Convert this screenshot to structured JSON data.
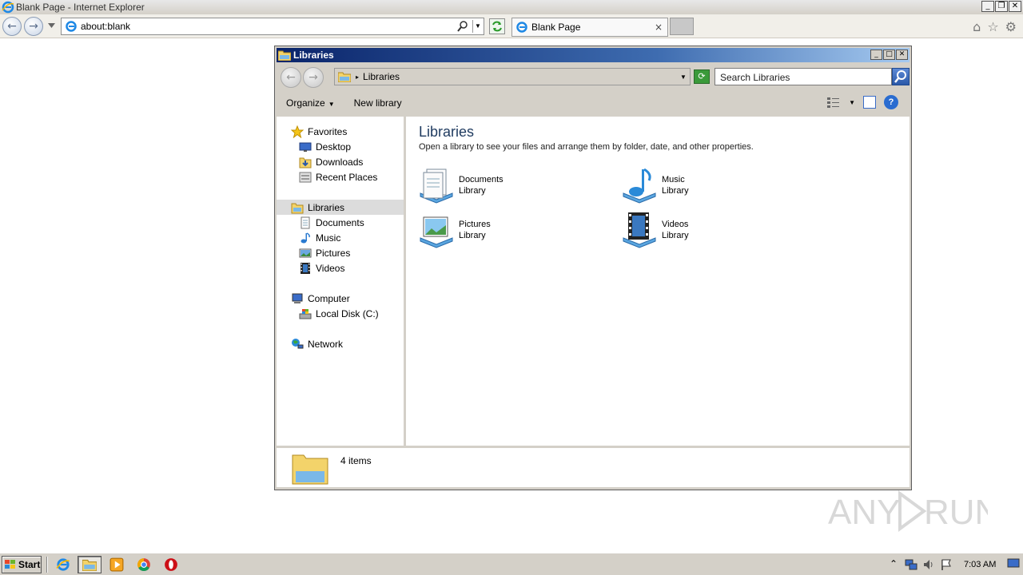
{
  "browser": {
    "window_title": "Blank Page - Internet Explorer",
    "address": "about:blank",
    "tab_label": "Blank Page",
    "tab_close": "×",
    "buttons": {
      "back": "←",
      "forward": "→",
      "minimize": "_",
      "restore": "❐",
      "close": "✕"
    },
    "right_icons": {
      "home": "⌂",
      "favorites": "☆",
      "settings": "⚙"
    }
  },
  "explorer": {
    "window_title": "Libraries",
    "window_buttons": {
      "minimize": "_",
      "maximize": "□",
      "close": "✕"
    },
    "breadcrumb": "Libraries",
    "search_placeholder": "Search Libraries",
    "toolbar": {
      "organize": "Organize",
      "new_library": "New library",
      "help": "?"
    },
    "nav": {
      "favorites": {
        "label": "Favorites",
        "items": [
          "Desktop",
          "Downloads",
          "Recent Places"
        ]
      },
      "libraries": {
        "label": "Libraries",
        "items": [
          "Documents",
          "Music",
          "Pictures",
          "Videos"
        ]
      },
      "computer": {
        "label": "Computer",
        "items": [
          "Local Disk (C:)"
        ]
      },
      "network": {
        "label": "Network"
      }
    },
    "content": {
      "title": "Libraries",
      "subtitle": "Open a library to see your files and arrange them by folder, date, and other properties.",
      "libraries": [
        {
          "name": "Documents",
          "kind": "Library",
          "icon": "documents-library-icon"
        },
        {
          "name": "Music",
          "kind": "Library",
          "icon": "music-library-icon"
        },
        {
          "name": "Pictures",
          "kind": "Library",
          "icon": "pictures-library-icon"
        },
        {
          "name": "Videos",
          "kind": "Library",
          "icon": "videos-library-icon"
        }
      ]
    },
    "status": "4 items"
  },
  "taskbar": {
    "start_label": "Start",
    "clock": "7:03 AM",
    "pinned": [
      "internet-explorer-icon",
      "windows-explorer-icon",
      "media-player-icon",
      "chrome-icon",
      "opera-icon"
    ]
  },
  "watermark": "ANY RUN",
  "colors": {
    "title_gradient_start": "#0a246a",
    "title_gradient_end": "#a6caf0",
    "chrome_gray": "#d4d0c8",
    "link_blue": "#1e3a5f"
  }
}
